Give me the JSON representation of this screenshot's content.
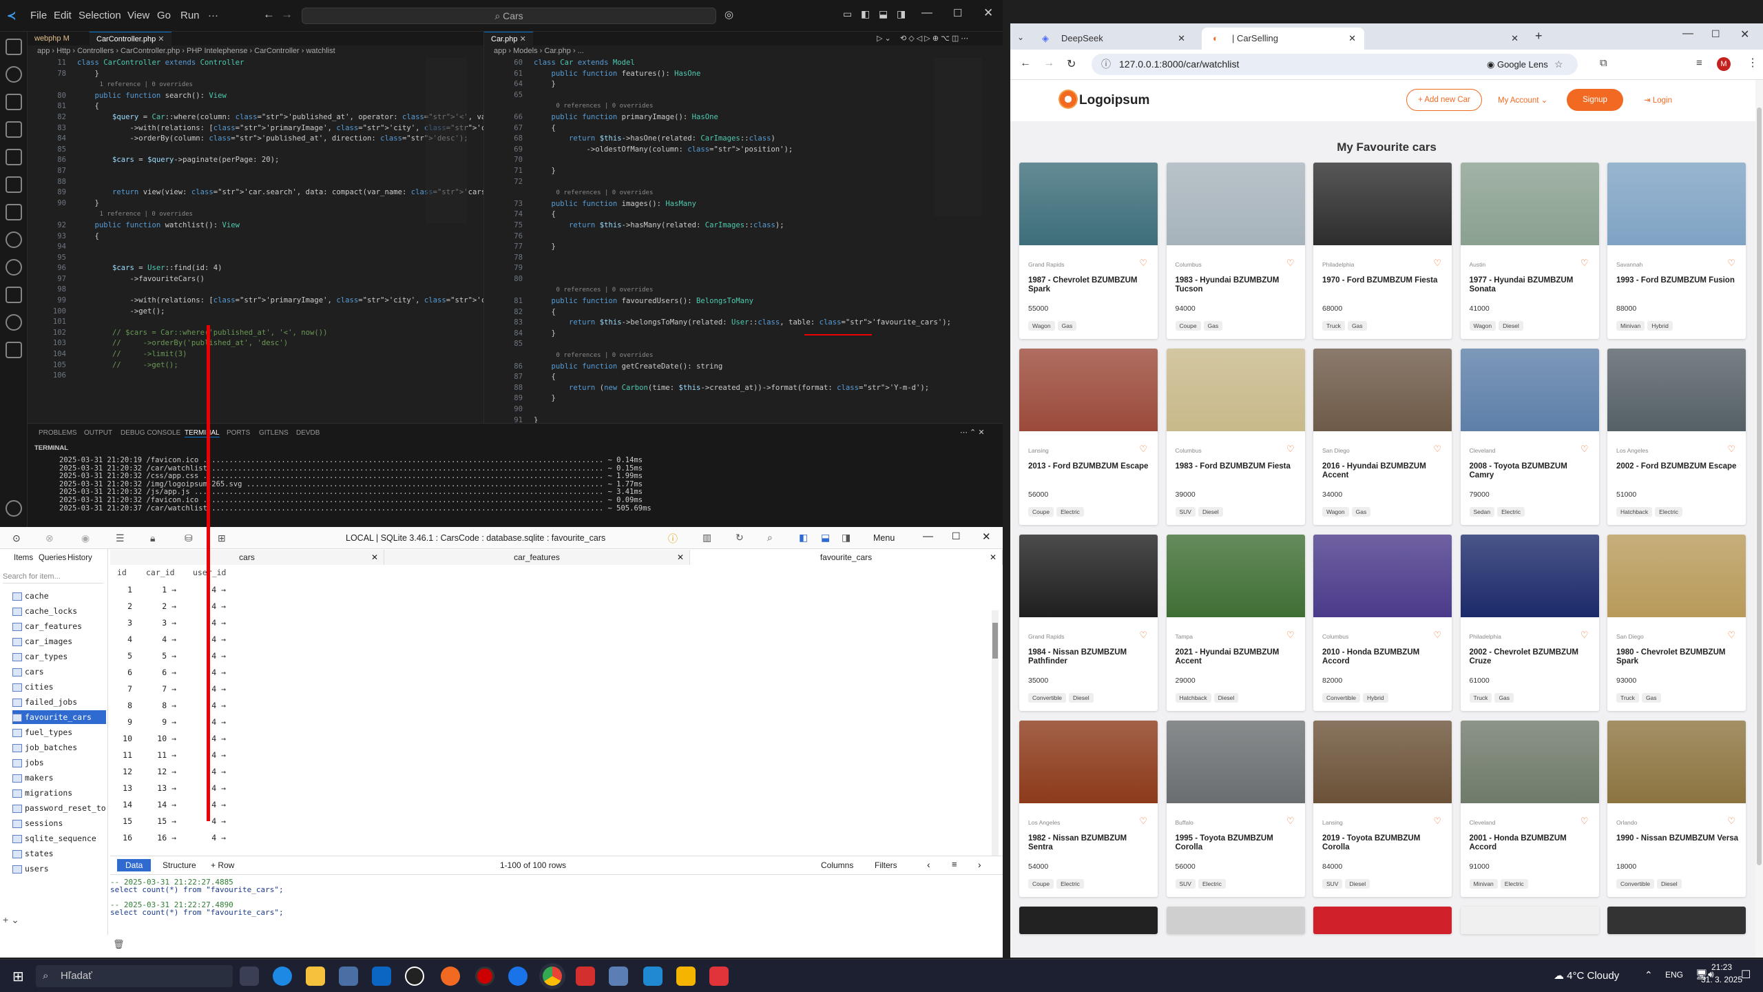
{
  "vscode": {
    "menu": [
      "File",
      "Edit",
      "Selection",
      "View",
      "Go",
      "Run",
      "···"
    ],
    "search_placeholder": "Cars",
    "left_tabs": [
      "webphp M",
      "CarController.php"
    ],
    "right_tabs": [
      "Car.php"
    ],
    "left_breadcrumb": "app › Http › Controllers › CarController.php › PHP Intelephense › CarController › watchlist",
    "right_breadcrumb": "app › Models › Car.php › ...",
    "left_code": [
      {
        "n": "11",
        "t": "class CarController extends Controller"
      },
      {
        "n": "78",
        "t": "    }"
      },
      {
        "n": "",
        "t": "      1 reference | 0 overrides"
      },
      {
        "n": "80",
        "t": "    public function search(): View"
      },
      {
        "n": "81",
        "t": "    {"
      },
      {
        "n": "82",
        "t": "        $query = Car::where(column: 'published_at', operator: '<', value: now("
      },
      {
        "n": "83",
        "t": "            ->with(relations: ['primaryImage', 'city', 'carType', 'fuelType',"
      },
      {
        "n": "84",
        "t": "            ->orderBy(column: 'published_at', direction: 'desc');"
      },
      {
        "n": "85",
        "t": ""
      },
      {
        "n": "86",
        "t": "        $cars = $query->paginate(perPage: 20);"
      },
      {
        "n": "87",
        "t": ""
      },
      {
        "n": "88",
        "t": ""
      },
      {
        "n": "89",
        "t": "        return view(view: 'car.search', data: compact(var_name: 'cars'));"
      },
      {
        "n": "90",
        "t": "    }"
      },
      {
        "n": "",
        "t": "      1 reference | 0 overrides"
      },
      {
        "n": "92",
        "t": "    public function watchlist(): View"
      },
      {
        "n": "93",
        "t": "    {"
      },
      {
        "n": "94",
        "t": ""
      },
      {
        "n": "95",
        "t": ""
      },
      {
        "n": "96",
        "t": "        $cars = User::find(id: 4)"
      },
      {
        "n": "97",
        "t": "            ->favouriteCars()"
      },
      {
        "n": "98",
        "t": ""
      },
      {
        "n": "99",
        "t": "            ->with(relations: ['primaryImage', 'city', 'carType', 'fuelType',"
      },
      {
        "n": "100",
        "t": "            ->get();"
      },
      {
        "n": "101",
        "t": ""
      },
      {
        "n": "102",
        "t": "        // $cars = Car::where('published_at', '<', now())"
      },
      {
        "n": "103",
        "t": "        //     ->orderBy('published_at', 'desc')"
      },
      {
        "n": "104",
        "t": "        //     ->limit(3)"
      },
      {
        "n": "105",
        "t": "        //     ->get();"
      },
      {
        "n": "106",
        "t": ""
      }
    ],
    "right_code": [
      {
        "n": "60",
        "t": "class Car extends Model"
      },
      {
        "n": "61",
        "t": "    public function features(): HasOne"
      },
      {
        "n": "64",
        "t": "    }"
      },
      {
        "n": "65",
        "t": ""
      },
      {
        "n": "",
        "t": "      0 references | 0 overrides"
      },
      {
        "n": "66",
        "t": "    public function primaryImage(): HasOne"
      },
      {
        "n": "67",
        "t": "    {"
      },
      {
        "n": "68",
        "t": "        return $this->hasOne(related: CarImages::class)"
      },
      {
        "n": "69",
        "t": "            ->oldestOfMany(column: 'position');"
      },
      {
        "n": "70",
        "t": ""
      },
      {
        "n": "71",
        "t": "    }"
      },
      {
        "n": "72",
        "t": ""
      },
      {
        "n": "",
        "t": "      0 references | 0 overrides"
      },
      {
        "n": "73",
        "t": "    public function images(): HasMany"
      },
      {
        "n": "74",
        "t": "    {"
      },
      {
        "n": "75",
        "t": "        return $this->hasMany(related: CarImages::class);"
      },
      {
        "n": "76",
        "t": ""
      },
      {
        "n": "77",
        "t": "    }"
      },
      {
        "n": "78",
        "t": ""
      },
      {
        "n": "79",
        "t": ""
      },
      {
        "n": "80",
        "t": ""
      },
      {
        "n": "",
        "t": "      0 references | 0 overrides"
      },
      {
        "n": "81",
        "t": "    public function favouredUsers(): BelongsToMany"
      },
      {
        "n": "82",
        "t": "    {"
      },
      {
        "n": "83",
        "t": "        return $this->belongsToMany(related: User::class, table: 'favourite_cars');"
      },
      {
        "n": "84",
        "t": "    }"
      },
      {
        "n": "85",
        "t": ""
      },
      {
        "n": "",
        "t": "      0 references | 0 overrides"
      },
      {
        "n": "86",
        "t": "    public function getCreateDate(): string"
      },
      {
        "n": "87",
        "t": "    {"
      },
      {
        "n": "88",
        "t": "        return (new Carbon(time: $this->created_at))->format(format: 'Y-m-d');"
      },
      {
        "n": "89",
        "t": "    }"
      },
      {
        "n": "90",
        "t": ""
      },
      {
        "n": "91",
        "t": "}"
      }
    ],
    "panel_tabs": [
      "PROBLEMS",
      "OUTPUT",
      "DEBUG CONSOLE",
      "TERMINAL",
      "PORTS",
      "GITLENS",
      "DEVDB"
    ],
    "terminal_label": "TERMINAL",
    "terminal_lines": [
      "2025-03-31 21:20:19 /favicon.ico ............................................................................................ ~ 0.14ms",
      "2025-03-31 21:20:32 /car/watchlist .......................................................................................... ~ 0.15ms",
      "2025-03-31 21:20:32 /css/app.css ............................................................................................ ~ 1.99ms",
      "2025-03-31 21:20:32 /img/logoipsum-265.svg .................................................................................. ~ 1.77ms",
      "2025-03-31 21:20:32 /js/app.js .............................................................................................. ~ 3.41ms",
      "2025-03-31 21:20:32 /favicon.ico ............................................................................................ ~ 0.09ms",
      "2025-03-31 21:20:37 /car/watchlist .......................................................................................... ~ 505.69ms"
    ]
  },
  "db": {
    "title": "LOCAL | SQLite 3.46.1 : CarsCode : database.sqlite : favourite_cars",
    "menu_label": "Menu",
    "side_tabs": [
      "Items",
      "Queries",
      "History"
    ],
    "search_placeholder": "Search for item...",
    "tables": [
      "cache",
      "cache_locks",
      "car_features",
      "car_images",
      "car_types",
      "cars",
      "cities",
      "failed_jobs",
      "favourite_cars",
      "fuel_types",
      "job_batches",
      "jobs",
      "makers",
      "migrations",
      "password_reset_to",
      "sessions",
      "sqlite_sequence",
      "states",
      "users"
    ],
    "selected_table": "favourite_cars",
    "grid_tabs": [
      "cars",
      "car_features",
      "favourite_cars"
    ],
    "columns": [
      "id",
      "car_id",
      "user_id"
    ],
    "rows": [
      [
        1,
        1,
        4
      ],
      [
        2,
        2,
        4
      ],
      [
        3,
        3,
        4
      ],
      [
        4,
        4,
        4
      ],
      [
        5,
        5,
        4
      ],
      [
        6,
        6,
        4
      ],
      [
        7,
        7,
        4
      ],
      [
        8,
        8,
        4
      ],
      [
        9,
        9,
        4
      ],
      [
        10,
        10,
        4
      ],
      [
        11,
        11,
        4
      ],
      [
        12,
        12,
        4
      ],
      [
        13,
        13,
        4
      ],
      [
        14,
        14,
        4
      ],
      [
        15,
        15,
        4
      ],
      [
        16,
        16,
        4
      ]
    ],
    "bottom": {
      "data": "Data",
      "structure": "Structure",
      "row": "+ Row",
      "count": "1-100 of 100 rows",
      "columns": "Columns",
      "filters": "Filters"
    },
    "log": [
      "-- 2025-03-31 21:22:27.4885",
      "select count(*) from \"favourite_cars\";",
      "",
      "-- 2025-03-31 21:22:27.4890",
      "select count(*) from \"favourite_cars\";"
    ]
  },
  "browser": {
    "tabs": [
      "DeepSeek",
      "| CarSelling",
      ""
    ],
    "url": "127.0.0.1:8000/car/watchlist",
    "lens_label": "Google Lens",
    "profile_initial": "M",
    "site": {
      "logo": "Logoipsum",
      "add_new_car": "+ Add new Car",
      "my_account": "My Account ⌄",
      "signup": "Signup",
      "login": "Login",
      "page_title": "My Favourite cars"
    },
    "cars": [
      {
        "city": "Grand Rapids",
        "name": "1987 - Chevrolet BZUMBZUM Spark",
        "price": "55000",
        "tags": [
          "Wagon",
          "Gas"
        ],
        "img": "#3d6e7a"
      },
      {
        "city": "Columbus",
        "name": "1983 - Hyundai BZUMBZUM Tucson",
        "price": "94000",
        "tags": [
          "Coupe",
          "Gas"
        ],
        "img": "#a7b3bb"
      },
      {
        "city": "Philadelphia",
        "name": "1970 - Ford BZUMBZUM Fiesta",
        "price": "68000",
        "tags": [
          "Truck",
          "Gas"
        ],
        "img": "#2d2d2d"
      },
      {
        "city": "Austin",
        "name": "1977 - Hyundai BZUMBZUM Sonata",
        "price": "41000",
        "tags": [
          "Wagon",
          "Diesel"
        ],
        "img": "#8aa090"
      },
      {
        "city": "Savannah",
        "name": "1993 - Ford BZUMBZUM Fusion",
        "price": "88000",
        "tags": [
          "Minivan",
          "Hybrid"
        ],
        "img": "#7fa3c4"
      },
      {
        "city": "Lansing",
        "name": "2013 - Ford BZUMBZUM Escape",
        "price": "56000",
        "tags": [
          "Coupe",
          "Electric"
        ],
        "img": "#9b4a3a"
      },
      {
        "city": "Columbus",
        "name": "1983 - Ford BZUMBZUM Fiesta",
        "price": "39000",
        "tags": [
          "SUV",
          "Diesel"
        ],
        "img": "#c8b98a"
      },
      {
        "city": "San Diego",
        "name": "2016 - Hyundai BZUMBZUM Accent",
        "price": "34000",
        "tags": [
          "Wagon",
          "Gas"
        ],
        "img": "#6e5a48"
      },
      {
        "city": "Cleveland",
        "name": "2008 - Toyota BZUMBZUM Camry",
        "price": "79000",
        "tags": [
          "Sedan",
          "Electric"
        ],
        "img": "#5d7fa8"
      },
      {
        "city": "Los Angeles",
        "name": "2002 - Ford BZUMBZUM Escape",
        "price": "51000",
        "tags": [
          "Hatchback",
          "Electric"
        ],
        "img": "#556066"
      },
      {
        "city": "Grand Rapids",
        "name": "1984 - Nissan BZUMBZUM Pathfinder",
        "price": "35000",
        "tags": [
          "Convertible",
          "Diesel"
        ],
        "img": "#1f1f1f"
      },
      {
        "city": "Tampa",
        "name": "2021 - Hyundai BZUMBZUM Accent",
        "price": "29000",
        "tags": [
          "Hatchback",
          "Diesel"
        ],
        "img": "#3f6e34"
      },
      {
        "city": "Columbus",
        "name": "2010 - Honda BZUMBZUM Accord",
        "price": "82000",
        "tags": [
          "Convertible",
          "Hybrid"
        ],
        "img": "#4b3a8a"
      },
      {
        "city": "Philadelphia",
        "name": "2002 - Chevrolet BZUMBZUM Cruze",
        "price": "61000",
        "tags": [
          "Truck",
          "Gas"
        ],
        "img": "#1c2a6a"
      },
      {
        "city": "San Diego",
        "name": "1980 - Chevrolet BZUMBZUM Spark",
        "price": "93000",
        "tags": [
          "Truck",
          "Gas"
        ],
        "img": "#b89a5a"
      },
      {
        "city": "Los Angeles",
        "name": "1982 - Nissan BZUMBZUM Sentra",
        "price": "54000",
        "tags": [
          "Coupe",
          "Electric"
        ],
        "img": "#8c3a1a"
      },
      {
        "city": "Buffalo",
        "name": "1995 - Toyota BZUMBZUM Corolla",
        "price": "56000",
        "tags": [
          "SUV",
          "Electric"
        ],
        "img": "#6a6e70"
      },
      {
        "city": "Lansing",
        "name": "2019 - Toyota BZUMBZUM Corolla",
        "price": "84000",
        "tags": [
          "SUV",
          "Diesel"
        ],
        "img": "#6b5238"
      },
      {
        "city": "Cleveland",
        "name": "2001 - Honda BZUMBZUM Accord",
        "price": "91000",
        "tags": [
          "Minivan",
          "Electric"
        ],
        "img": "#6f7a6a"
      },
      {
        "city": "Orlando",
        "name": "1990 - Nissan BZUMBZUM Versa",
        "price": "18000",
        "tags": [
          "Convertible",
          "Diesel"
        ],
        "img": "#8c7440"
      }
    ],
    "partial_row_colors": [
      "#222",
      "#cfcfcf",
      "#d0202a",
      "#f0f0f0",
      "#333"
    ]
  },
  "taskbar": {
    "search_placeholder": "Hľadať",
    "weather": "4°C Cloudy",
    "lang": "ENG",
    "time": "21:23",
    "date": "31. 3. 2025"
  }
}
